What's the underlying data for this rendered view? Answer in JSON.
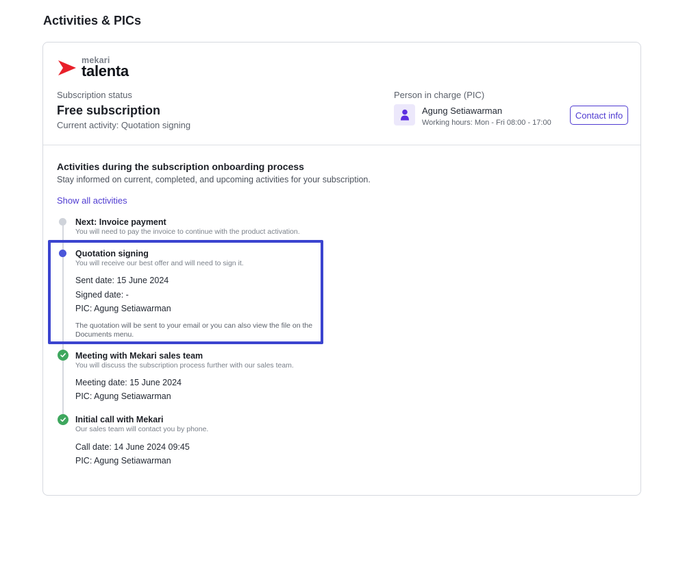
{
  "page": {
    "title": "Activities & PICs"
  },
  "brand": {
    "top": "mekari",
    "main": "talenta",
    "color": "#e8202a"
  },
  "subscription": {
    "label": "Subscription status",
    "value": "Free subscription",
    "activity": "Current activity: Quotation signing"
  },
  "pic": {
    "label": "Person in charge (PIC)",
    "name": "Agung Setiawarman",
    "hours": "Working hours: Mon - Fri 08:00 - 17:00",
    "contact_label": "Contact info",
    "avatar_icon": "person-icon"
  },
  "activities": {
    "title": "Activities during the subscription onboarding process",
    "description": "Stay informed on current, completed, and upcoming activities for your subscription.",
    "show_all_label": "Show all activities",
    "steps": [
      {
        "status": "upcoming",
        "title": "Next: Invoice payment",
        "subtitle": "You will need to pay the invoice to continue with the product activation."
      },
      {
        "status": "current",
        "title": "Quotation signing",
        "subtitle": "You will receive our best offer and will need to sign it.",
        "details": [
          "Sent date: 15 June 2024",
          "Signed date: -",
          "PIC: Agung Setiawarman"
        ],
        "note": "The quotation will be sent to your email or you can also view the file on the Documents menu."
      },
      {
        "status": "completed",
        "title": "Meeting with Mekari sales team",
        "subtitle": "You will discuss the subscription process further with our sales team.",
        "details": [
          "Meeting date: 15 June 2024",
          "PIC: Agung Setiawarman"
        ]
      },
      {
        "status": "completed",
        "title": "Initial call with Mekari",
        "subtitle": "Our sales team will contact you by phone.",
        "details": [
          "Call date: 14 June 2024 09:45",
          "PIC: Agung Setiawarman"
        ]
      }
    ]
  },
  "colors": {
    "accent": "#4f3bd1",
    "current_dot": "#4a56d9",
    "completed": "#3ea75e",
    "upcoming": "#cfd3da",
    "highlight": "#3b44cf"
  }
}
